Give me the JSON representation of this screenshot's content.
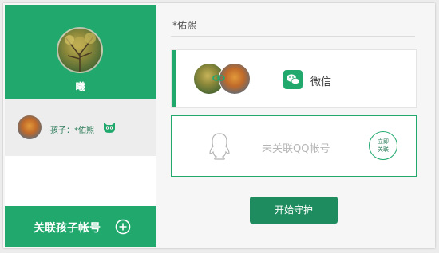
{
  "colors": {
    "accent": "#21a96d",
    "accent_dark": "#1e8c5f",
    "text_green": "#2e7d5b",
    "muted": "#b5b5b5"
  },
  "profile": {
    "name": "曦",
    "avatar_icon": "tree-photo-avatar"
  },
  "child": {
    "label": "孩子：*佑熙",
    "avatar_icon": "child-photo-avatar",
    "badge_icon": "cat-face-icon"
  },
  "link_child_button": {
    "label": "关联孩子帐号",
    "icon": "plus-circle-icon"
  },
  "right": {
    "title": "*佑熙"
  },
  "wechat_card": {
    "label": "微信",
    "icon": "wechat-icon"
  },
  "qq_card": {
    "label": "未关联QQ帐号",
    "icon": "qq-penguin-icon",
    "link_line1": "立即",
    "link_line2": "关联"
  },
  "start_button": {
    "label": "开始守护"
  }
}
